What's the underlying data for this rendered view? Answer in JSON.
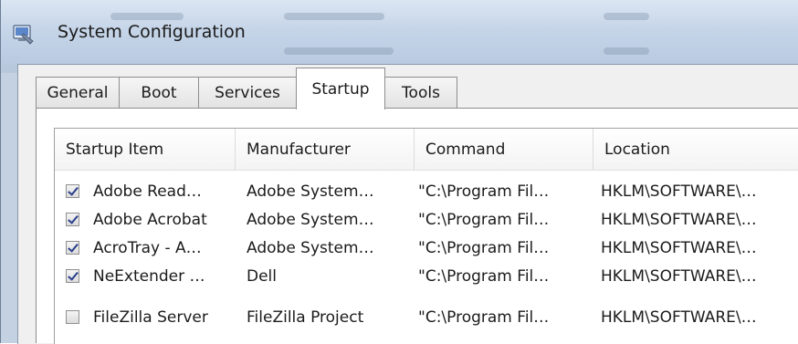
{
  "window": {
    "title": "System Configuration"
  },
  "tabs": [
    {
      "label": "General",
      "active": false
    },
    {
      "label": "Boot",
      "active": false
    },
    {
      "label": "Services",
      "active": false
    },
    {
      "label": "Startup",
      "active": true
    },
    {
      "label": "Tools",
      "active": false
    }
  ],
  "list": {
    "columns": [
      "Startup Item",
      "Manufacturer",
      "Command",
      "Location"
    ],
    "rows": [
      {
        "checked": true,
        "item": "Adobe Read…",
        "manufacturer": "Adobe System…",
        "command": "\"C:\\Program Fil…",
        "location": "HKLM\\SOFTWARE\\…"
      },
      {
        "checked": true,
        "item": "Adobe Acrobat",
        "manufacturer": "Adobe System…",
        "command": "\"C:\\Program Fil…",
        "location": "HKLM\\SOFTWARE\\…"
      },
      {
        "checked": true,
        "item": "AcroTray - A…",
        "manufacturer": "Adobe System…",
        "command": "\"C:\\Program Fil…",
        "location": "HKLM\\SOFTWARE\\…"
      },
      {
        "checked": true,
        "item": "NeExtender …",
        "manufacturer": "Dell",
        "command": "\"C:\\Program Fil…",
        "location": "HKLM\\SOFTWARE\\…"
      },
      {
        "checked": false,
        "item": "FileZilla Server",
        "manufacturer": "FileZilla Project",
        "command": "\"C:\\Program Fil…",
        "location": "HKLM\\SOFTWARE\\…"
      }
    ]
  },
  "colors": {
    "highlight": "#f6f77a",
    "check": "#2a3f8c"
  },
  "icons": {
    "app": "msconfig-icon",
    "checkbox": "checkbox-icon"
  }
}
